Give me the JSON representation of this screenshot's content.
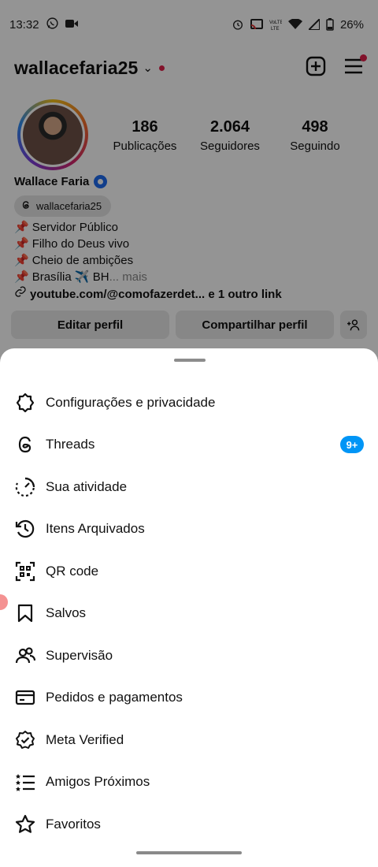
{
  "status_bar": {
    "time": "13:32",
    "battery": "26%"
  },
  "profile": {
    "username": "wallacefaria25",
    "stats": [
      {
        "value": "186",
        "label": "Publicações"
      },
      {
        "value": "2.064",
        "label": "Seguidores"
      },
      {
        "value": "498",
        "label": "Seguindo"
      }
    ],
    "display_name": "Wallace Faria",
    "threads_handle": "wallacefaria25",
    "bio": [
      {
        "text": "Servidor Público",
        "more": ""
      },
      {
        "text": "Filho do Deus vivo",
        "more": ""
      },
      {
        "text": "Cheio de ambições",
        "more": ""
      },
      {
        "text": "Brasília ✈️ BH",
        "more": "... mais"
      }
    ],
    "link": "youtube.com/@comofazerdet... e 1 outro link",
    "buttons": {
      "edit": "Editar perfil",
      "share": "Compartilhar perfil"
    }
  },
  "menu": {
    "items": [
      {
        "label": "Configurações e privacidade",
        "icon": "settings-icon"
      },
      {
        "label": "Threads",
        "icon": "threads-icon",
        "badge": "9+"
      },
      {
        "label": "Sua atividade",
        "icon": "activity-icon"
      },
      {
        "label": "Itens Arquivados",
        "icon": "archive-icon"
      },
      {
        "label": "QR code",
        "icon": "qr-code-icon"
      },
      {
        "label": "Salvos",
        "icon": "bookmark-icon"
      },
      {
        "label": "Supervisão",
        "icon": "supervision-icon"
      },
      {
        "label": "Pedidos e pagamentos",
        "icon": "card-icon"
      },
      {
        "label": "Meta Verified",
        "icon": "meta-verified-icon"
      },
      {
        "label": "Amigos Próximos",
        "icon": "close-friends-icon"
      },
      {
        "label": "Favoritos",
        "icon": "star-icon"
      }
    ]
  },
  "colors": {
    "badge": "#0095f6",
    "notification_dot": "#e0204a",
    "scrim": "rgba(0,0,0,0.42)"
  }
}
